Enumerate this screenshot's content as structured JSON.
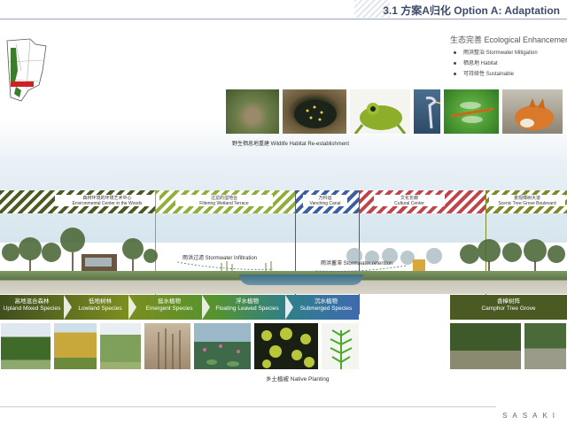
{
  "header": {
    "title": "3.1 方案A归化 Option A: Adaptation"
  },
  "legend": {
    "title": "生态完善 Ecological Enhancement",
    "items": [
      "雨洪整治 Stormwater Mitigation",
      "栖息地 Habitat",
      "可持续性 Sustainable"
    ]
  },
  "wildlife": {
    "photos": [
      "mouse-photo",
      "turtle-photo",
      "frog-photo",
      "heron-photo",
      "dragonfly-photo",
      "fox-photo"
    ],
    "caption": "野生栖息地重建 Wildlife Habitat Re-establishment"
  },
  "zones": [
    {
      "label_cn": "森林环境的环境艺术中心",
      "label_en": "Environmental Center in the Woods"
    },
    {
      "label_cn": "过滤的湿地台",
      "label_en": "Filtering Wetland Terrace"
    },
    {
      "label_cn": "万科运",
      "label_en": "Vanching Canal"
    },
    {
      "label_cn": "文化长廊",
      "label_en": "Cultural Center"
    },
    {
      "label_cn": "景观樟树大道",
      "label_en": "Scenic Tree Grove Boulevard"
    }
  ],
  "annotations": {
    "infiltration": "雨洪过滤 Stormwater Infiltration",
    "retention": "雨洪蓄滞 Stormwater retention"
  },
  "planting": [
    {
      "cn": "高地混合森林",
      "en": "Upland Mixed Species"
    },
    {
      "cn": "低地树林",
      "en": "Lowland Species"
    },
    {
      "cn": "挺水植物",
      "en": "Emergent Species"
    },
    {
      "cn": "浮水植物",
      "en": "Floating Leaved Species"
    },
    {
      "cn": "沉水植物",
      "en": "Submerged Species"
    }
  ],
  "camphor": {
    "cn": "香樟树阵",
    "en": "Camphor Tree Grove"
  },
  "native_caption": "乡土植被 Native Planting",
  "brand": "SASAKI",
  "colors": {
    "title": "#3d4b6b",
    "band_start": "#3f4f1e",
    "band_end": "#3f6ab0",
    "camphor": "#4a5a22"
  }
}
